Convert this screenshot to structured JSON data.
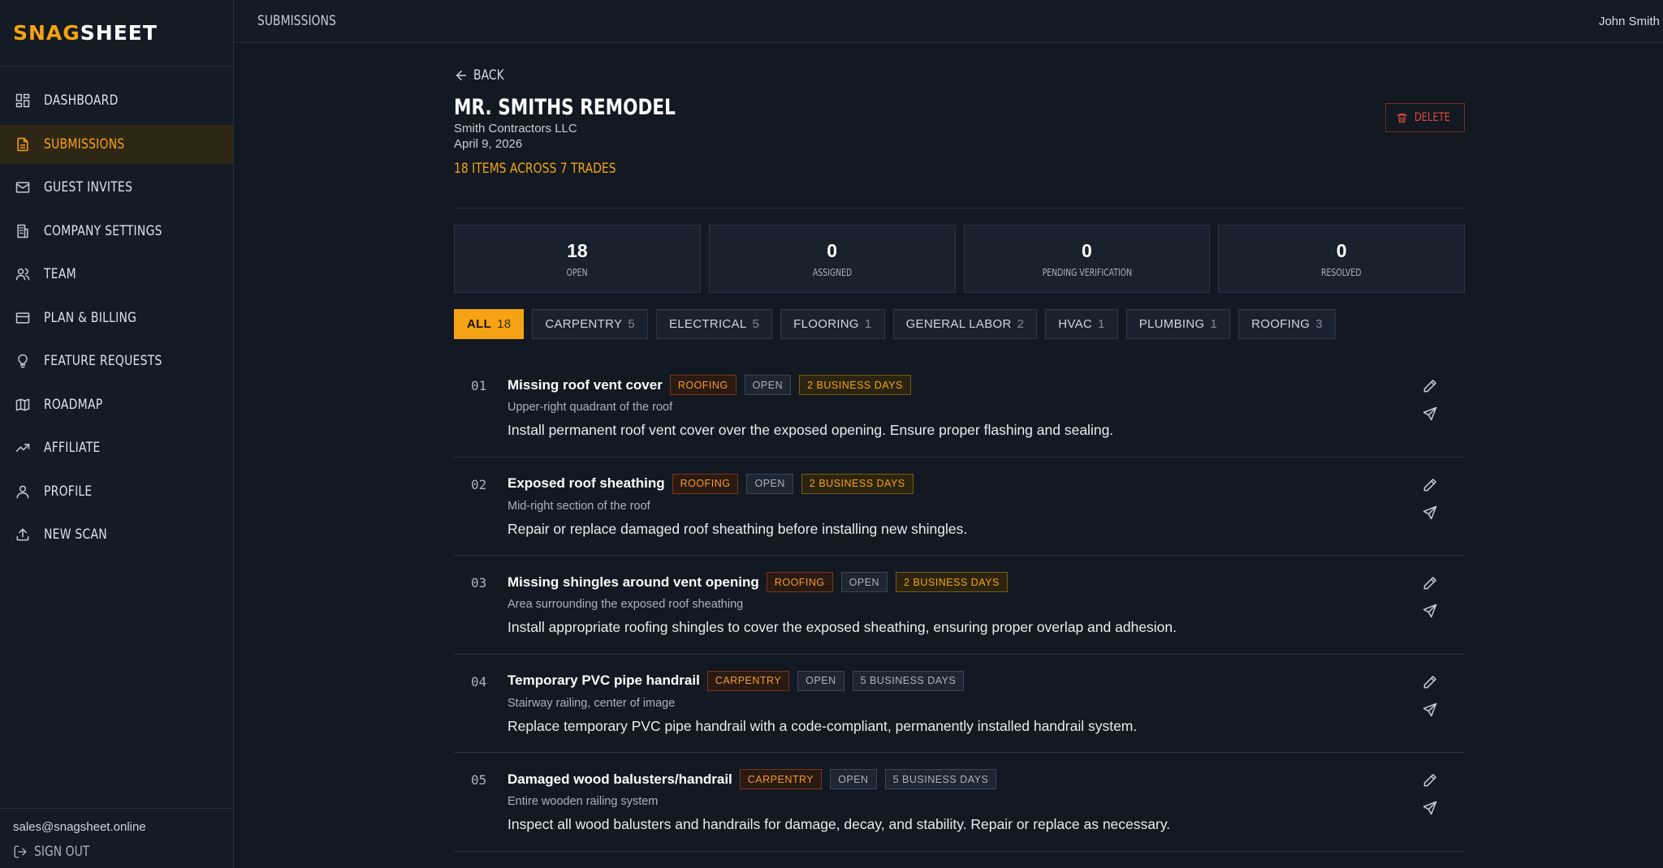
{
  "brand": {
    "part1": "SNAG",
    "part2": "SHEET"
  },
  "nav": [
    {
      "label": "DASHBOARD",
      "icon": "dashboard-icon",
      "active": false
    },
    {
      "label": "SUBMISSIONS",
      "icon": "document-icon",
      "active": true
    },
    {
      "label": "GUEST INVITES",
      "icon": "mail-icon",
      "active": false
    },
    {
      "label": "COMPANY SETTINGS",
      "icon": "building-icon",
      "active": false
    },
    {
      "label": "TEAM",
      "icon": "users-icon",
      "active": false
    },
    {
      "label": "PLAN & BILLING",
      "icon": "credit-card-icon",
      "active": false
    },
    {
      "label": "FEATURE REQUESTS",
      "icon": "lightbulb-icon",
      "active": false
    },
    {
      "label": "ROADMAP",
      "icon": "map-icon",
      "active": false
    },
    {
      "label": "AFFILIATE",
      "icon": "trending-up-icon",
      "active": false
    },
    {
      "label": "PROFILE",
      "icon": "user-icon",
      "active": false
    },
    {
      "label": "NEW SCAN",
      "icon": "upload-icon",
      "active": false
    }
  ],
  "sidebar_footer": {
    "email": "sales@snagsheet.online",
    "signout": "SIGN OUT"
  },
  "topbar": {
    "breadcrumb": "SUBMISSIONS",
    "user": "John Smith"
  },
  "page": {
    "back": "BACK",
    "title": "MR. SMITHS REMODEL",
    "company": "Smith Contractors LLC",
    "date": "April 9, 2026",
    "summary": "18 ITEMS ACROSS 7 TRADES",
    "delete": "DELETE"
  },
  "stats": [
    {
      "value": "18",
      "label": "OPEN"
    },
    {
      "value": "0",
      "label": "ASSIGNED"
    },
    {
      "value": "0",
      "label": "PENDING VERIFICATION"
    },
    {
      "value": "0",
      "label": "RESOLVED"
    }
  ],
  "filters": [
    {
      "label": "ALL",
      "count": "18",
      "active": true
    },
    {
      "label": "CARPENTRY",
      "count": "5",
      "active": false
    },
    {
      "label": "ELECTRICAL",
      "count": "5",
      "active": false
    },
    {
      "label": "FLOORING",
      "count": "1",
      "active": false
    },
    {
      "label": "GENERAL LABOR",
      "count": "2",
      "active": false
    },
    {
      "label": "HVAC",
      "count": "1",
      "active": false
    },
    {
      "label": "PLUMBING",
      "count": "1",
      "active": false
    },
    {
      "label": "ROOFING",
      "count": "3",
      "active": false
    }
  ],
  "items": [
    {
      "index": "01",
      "title": "Missing roof vent cover",
      "trade": "ROOFING",
      "status": "OPEN",
      "due": "2 BUSINESS DAYS",
      "due_urgent": true,
      "location": "Upper-right quadrant of the roof",
      "description": "Install permanent roof vent cover over the exposed opening. Ensure proper flashing and sealing."
    },
    {
      "index": "02",
      "title": "Exposed roof sheathing",
      "trade": "ROOFING",
      "status": "OPEN",
      "due": "2 BUSINESS DAYS",
      "due_urgent": true,
      "location": "Mid-right section of the roof",
      "description": "Repair or replace damaged roof sheathing before installing new shingles."
    },
    {
      "index": "03",
      "title": "Missing shingles around vent opening",
      "trade": "ROOFING",
      "status": "OPEN",
      "due": "2 BUSINESS DAYS",
      "due_urgent": true,
      "location": "Area surrounding the exposed roof sheathing",
      "description": "Install appropriate roofing shingles to cover the exposed sheathing, ensuring proper overlap and adhesion."
    },
    {
      "index": "04",
      "title": "Temporary PVC pipe handrail",
      "trade": "CARPENTRY",
      "status": "OPEN",
      "due": "5 BUSINESS DAYS",
      "due_urgent": false,
      "location": "Stairway railing, center of image",
      "description": "Replace temporary PVC pipe handrail with a code-compliant, permanently installed handrail system."
    },
    {
      "index": "05",
      "title": "Damaged wood balusters/handrail",
      "trade": "CARPENTRY",
      "status": "OPEN",
      "due": "5 BUSINESS DAYS",
      "due_urgent": false,
      "location": "Entire wooden railing system",
      "description": "Inspect all wood balusters and handrails for damage, decay, and stability. Repair or replace as necessary."
    }
  ],
  "colors": {
    "accent": "#f5a313",
    "danger": "#e2473a",
    "background": "#121922",
    "sidebar": "#141b24"
  }
}
